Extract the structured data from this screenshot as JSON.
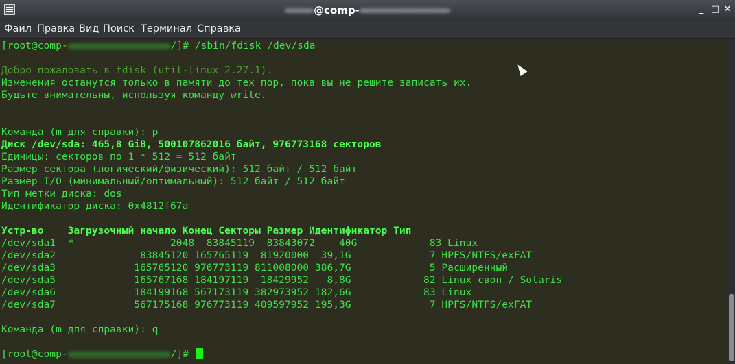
{
  "window": {
    "title": "@comp-"
  },
  "menu": [
    "Файл",
    "Правка",
    "Вид",
    "Поиск",
    "Терминал",
    "Справка"
  ],
  "terminal": {
    "lines": [
      "[root@comp-",
      "/]# /sbin/fdisk /dev/sda",
      "Добро пожаловать в fdisk (util-linux 2.27.1).",
      "Изменения останутся только в памяти до тех пор, пока вы не решите записать их.",
      "Будьте внимательны, используя команду write.",
      "Команда (m для справки): p",
      "Диск /dev/sda: 465,8 GiB, 500107862016 байт, 976773168 секторов",
      "Единицы: секторов по 1 * 512 = 512 байт",
      "Размер сектора (логический/физический): 512 байт / 512 байт",
      "Размер I/O (минимальный/оптимальный): 512 байт / 512 байт",
      "Тип метки диска: dos",
      "Идентификатор диска: 0x4812f67a",
      "Устр-во    Загрузочный начало Конец Секторы Размер Идентификатор Тип",
      "/dev/sda1  *                2048  83845119  83843072    40G            83 Linux",
      "/dev/sda2              83845120 165765119  81920000  39,1G             7 HPFS/NTFS/exFAT",
      "/dev/sda3             165765120 976773119 811008000 386,7G             5 Расширенный",
      "/dev/sda5             165767168 184197119  18429952   8,8G            82 Linux своп / Solaris",
      "/dev/sda6             184199168 567173119 382973952 182,6G            83 Linux",
      "/dev/sda7             567175168 976773119 409597952 195,3G             7 HPFS/NTFS/exFAT",
      "Команда (m для справки): q",
      "[root@comp-",
      "/]# "
    ]
  },
  "colors": {
    "background": "#2d2d20",
    "text": "#3ee14a",
    "dim_text": "#4f9e30",
    "cursor": "#1bf21b"
  }
}
